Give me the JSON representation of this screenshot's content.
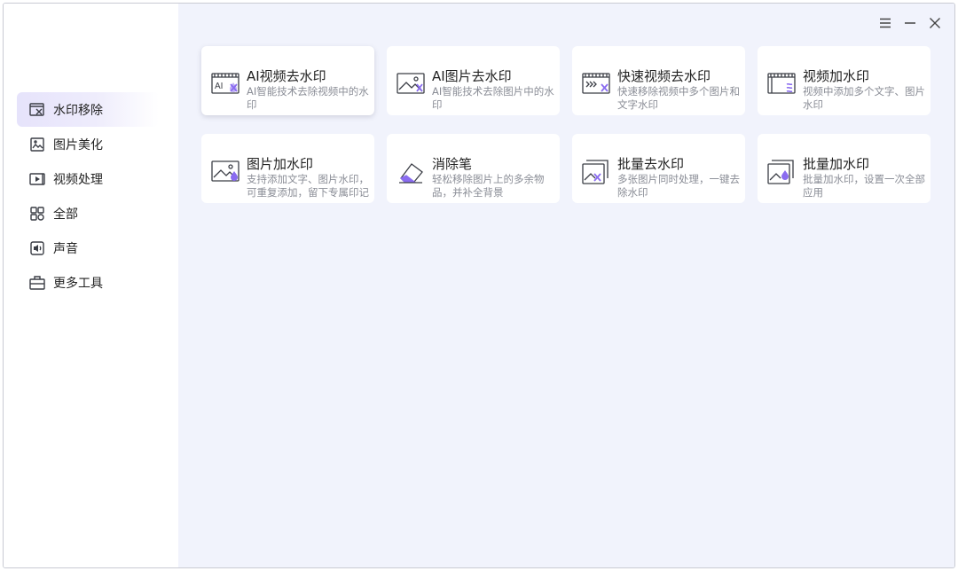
{
  "sidebar": {
    "items": [
      {
        "label": "水印移除",
        "icon": "watermark-remove-icon",
        "active": true
      },
      {
        "label": "图片美化",
        "icon": "image-beautify-icon",
        "active": false
      },
      {
        "label": "视频处理",
        "icon": "video-process-icon",
        "active": false
      },
      {
        "label": "全部",
        "icon": "grid-all-icon",
        "active": false
      },
      {
        "label": "声音",
        "icon": "audio-icon",
        "active": false
      },
      {
        "label": "更多工具",
        "icon": "toolbox-icon",
        "active": false
      }
    ]
  },
  "window_controls": {
    "menu": "menu-icon",
    "minimize": "minimize-icon",
    "close": "close-icon"
  },
  "cards": [
    {
      "title": "AI视频去水印",
      "desc": "AI智能技术去除视频中的水印",
      "icon": "ai-video-remove-icon"
    },
    {
      "title": "AI图片去水印",
      "desc": "AI智能技术去除图片中的水印",
      "icon": "ai-image-remove-icon"
    },
    {
      "title": "快速视频去水印",
      "desc": "快速移除视频中多个图片和文字水印",
      "icon": "fast-video-remove-icon"
    },
    {
      "title": "视频加水印",
      "desc": "视频中添加多个文字、图片水印",
      "icon": "video-add-watermark-icon"
    },
    {
      "title": "图片加水印",
      "desc": "支持添加文字、图片水印，可重复添加，留下专属印记",
      "icon": "image-add-watermark-icon"
    },
    {
      "title": "消除笔",
      "desc": "轻松移除图片上的多余物品，并补全背景",
      "icon": "eraser-icon"
    },
    {
      "title": "批量去水印",
      "desc": "多张图片同时处理，一键去除水印",
      "icon": "batch-remove-icon"
    },
    {
      "title": "批量加水印",
      "desc": "批量加水印，设置一次全部应用",
      "icon": "batch-add-icon"
    }
  ],
  "colors": {
    "accent": "#8a6cf0",
    "sidebar_active": "#e6e3fb",
    "main_bg": "#f1f3fc",
    "icon_stroke": "#3a3d45"
  }
}
